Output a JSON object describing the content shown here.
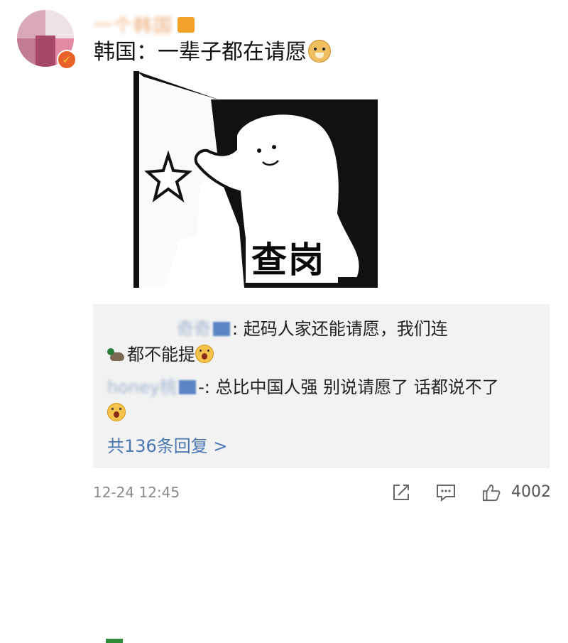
{
  "post": {
    "username": "一个韩国",
    "text": "韩国：一辈子都在请愿",
    "emoji": "doge-icon",
    "image_caption": "查岗"
  },
  "replies": {
    "items": [
      {
        "author": "奇奇",
        "text_line1": ": 起码人家还能请愿，我们连",
        "text_line2": "都不能提"
      },
      {
        "author": "honey桃",
        "text_line1": "-: 总比中国人强 别说请愿了 话都说不了",
        "text_line2": ""
      }
    ],
    "more_label": "共136条回复 >"
  },
  "footer": {
    "timestamp": "12-24 12:45",
    "like_count": "4002",
    "icons": [
      "share-icon",
      "comment-icon",
      "like-icon"
    ]
  },
  "colors": {
    "link": "#4a77b4",
    "reply_bg": "#f2f2f2",
    "meta_text": "#8a8a8a"
  }
}
